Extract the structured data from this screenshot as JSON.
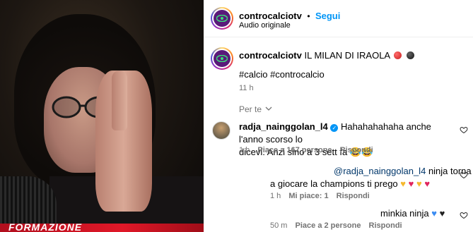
{
  "header": {
    "username": "controcalciotv",
    "separator": "•",
    "follow_label": "Segui",
    "audio_label": "Audio originale"
  },
  "caption": {
    "username": "controcalciotv",
    "text": "IL MILAN DI IRAOLA",
    "hashtags": "#calcio #controcalcio",
    "time": "11 h"
  },
  "sort": {
    "label": "Per te"
  },
  "comments": [
    {
      "username": "radja_nainggolan_l4",
      "text_line1": "Hahahahahaha anche l'anno scorso lo",
      "text_line2": "dicevi. Anzi sino a 3 sett fa",
      "time": "1 h",
      "likes": "Piace a 167 persone",
      "reply_label": "Rispondi"
    },
    {
      "mention": "@radja_nainggolan_l4",
      "text_line1": "ninja torna",
      "text_line2": "a giocare la champions ti prego",
      "time": "1 h",
      "likes": "Mi piace: 1",
      "reply_label": "Rispondi"
    },
    {
      "text_line1": "minkia ninja",
      "time": "50 m",
      "likes": "Piace a 2 persone",
      "reply_label": "Rispondi"
    }
  ],
  "video": {
    "banner_text": "FORMAZIONE"
  },
  "colors": {
    "blue_link": "#0095f6",
    "mention_link": "#00376b",
    "verified": "#0095f6",
    "muted": "#737373"
  }
}
